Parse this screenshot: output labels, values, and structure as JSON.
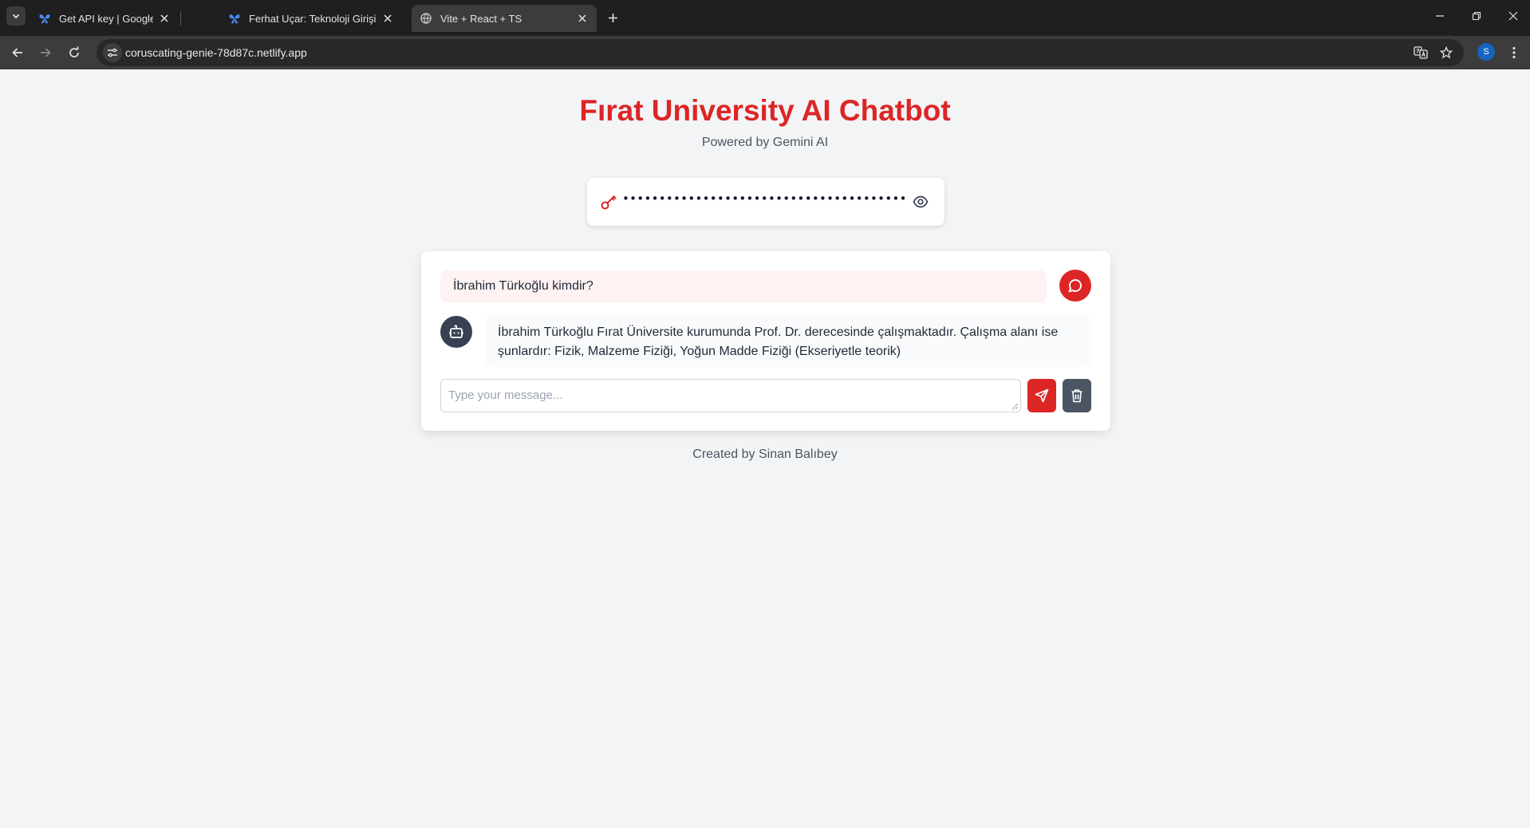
{
  "browser": {
    "tabs": [
      {
        "title": "Get API key | Google AI Studio",
        "favicon": "ai-studio-icon"
      },
      {
        "title": "Ferhat Uçar: Teknoloji Girişimcisi",
        "favicon": "ai-studio-icon"
      },
      {
        "title": "Vite + React + TS",
        "favicon": "globe-icon",
        "active": true
      }
    ],
    "url": "coruscating-genie-78d87c.netlify.app",
    "profile_initial": "S"
  },
  "header": {
    "title": "Fırat University AI Chatbot",
    "subtitle": "Powered by Gemini AI"
  },
  "api_key": {
    "masked_value": "•••••••••••••••••••••••••••••••••••••••",
    "key_icon": "key-icon",
    "toggle_icon": "eye-icon"
  },
  "chat": {
    "messages": [
      {
        "role": "user",
        "text": "İbrahim Türkoğlu kimdir?"
      },
      {
        "role": "bot",
        "text": "İbrahim Türkoğlu Fırat Üniversite kurumunda Prof. Dr. derecesinde çalışmaktadır. Çalışma alanı ise şunlardır: Fizik, Malzeme Fiziği, Yoğun Madde Fiziği (Ekseriyetle teorik)"
      }
    ],
    "input_placeholder": "Type your message...",
    "input_value": ""
  },
  "footer": {
    "text": "Created by Sinan Balıbey"
  },
  "colors": {
    "accent": "#dc2626",
    "dark": "#374151",
    "background": "#f3f4f6"
  }
}
